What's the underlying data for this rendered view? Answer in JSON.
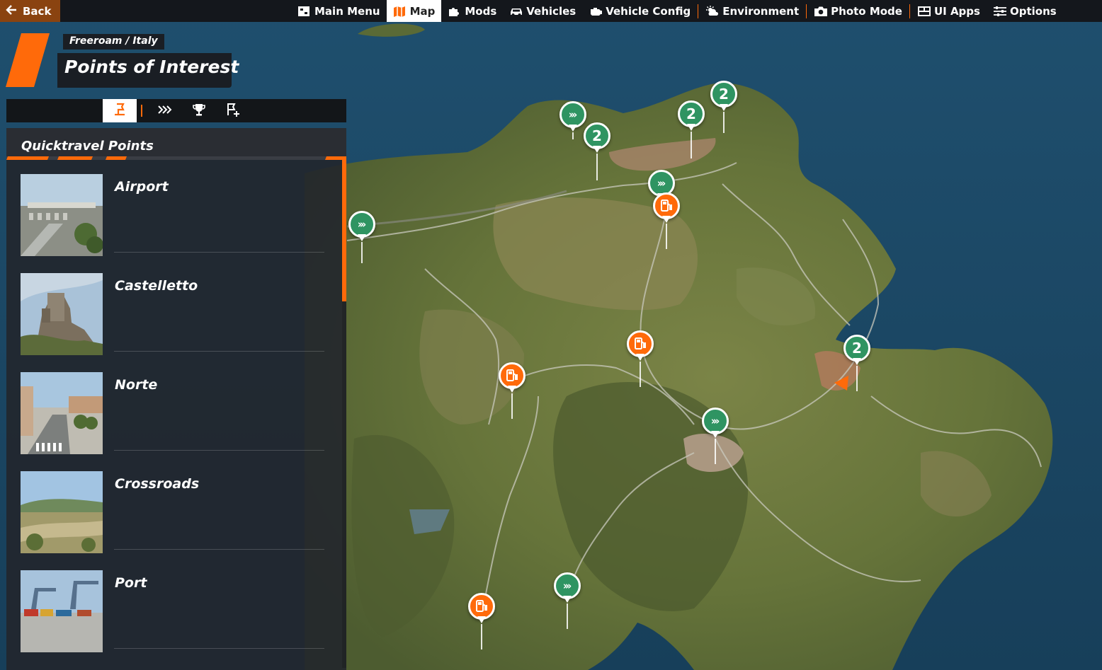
{
  "topbar": {
    "back_label": "Back",
    "nav": [
      {
        "label": "Main Menu",
        "icon": "main-menu-icon"
      },
      {
        "label": "Map",
        "icon": "map-icon",
        "active": true
      },
      {
        "label": "Mods",
        "icon": "puzzle-icon"
      },
      {
        "label": "Vehicles",
        "icon": "car-icon"
      },
      {
        "label": "Vehicle Config",
        "icon": "engine-icon"
      },
      {
        "label": "Environment",
        "icon": "weather-icon"
      },
      {
        "label": "Photo Mode",
        "icon": "camera-icon"
      },
      {
        "label": "UI Apps",
        "icon": "ui-apps-icon"
      },
      {
        "label": "Options",
        "icon": "sliders-icon"
      }
    ]
  },
  "header": {
    "breadcrumb": "Freeroam / Italy",
    "title": "Points of Interest"
  },
  "tabs": [
    {
      "icon": "spawn-flag-icon",
      "active": true
    },
    {
      "icon": "chevrons-icon"
    },
    {
      "icon": "trophy-icon"
    },
    {
      "icon": "add-flag-icon"
    }
  ],
  "list": {
    "title": "Quicktravel Points",
    "items": [
      {
        "label": "Airport"
      },
      {
        "label": "Castelletto"
      },
      {
        "label": "Norte"
      },
      {
        "label": "Crossroads"
      },
      {
        "label": "Port"
      }
    ]
  },
  "map": {
    "pins": [
      {
        "type": "quicktravel",
        "text": "›››"
      },
      {
        "type": "mission",
        "text": "2"
      },
      {
        "type": "mission",
        "text": "2"
      },
      {
        "type": "mission",
        "text": "2"
      },
      {
        "type": "quicktravel",
        "text": "›››"
      },
      {
        "type": "quicktravel",
        "text": "›››"
      },
      {
        "type": "gas-station"
      },
      {
        "type": "gas-station"
      },
      {
        "type": "gas-station"
      },
      {
        "type": "mission",
        "text": "2"
      },
      {
        "type": "quicktravel",
        "text": "›››"
      },
      {
        "type": "quicktravel",
        "text": "›››"
      },
      {
        "type": "gas-station"
      }
    ]
  },
  "colors": {
    "accent": "#ff6a0a",
    "quicktravel_pin": "#2f9462",
    "panel_bg": "#22262c",
    "sea": "#1b4a68",
    "land": "#6c7a3e"
  }
}
